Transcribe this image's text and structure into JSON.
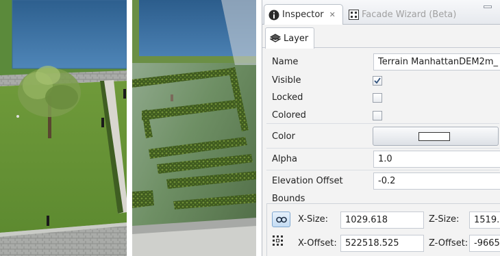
{
  "inspector": {
    "tabs": [
      {
        "label": "Inspector",
        "icon": "info-icon",
        "active": true
      },
      {
        "label": "Facade Wizard (Beta)",
        "icon": "facade-wizard-icon",
        "active": false
      }
    ],
    "subtab": {
      "label": "Layer",
      "icon": "layer-icon"
    },
    "fields": {
      "name": {
        "label": "Name",
        "value": "Terrain ManhattanDEM2m_"
      },
      "visible": {
        "label": "Visible",
        "checked": true
      },
      "locked": {
        "label": "Locked",
        "checked": false
      },
      "colored": {
        "label": "Colored",
        "checked": false
      },
      "color": {
        "label": "Color",
        "value_hex": "#ffffff"
      },
      "alpha": {
        "label": "Alpha",
        "value": "1.0"
      },
      "elevation_offset": {
        "label": "Elevation Offset",
        "value": "-0.2"
      }
    },
    "bounds": {
      "title": "Bounds",
      "x_size_label": "X-Size:",
      "x_size_value": "1029.618",
      "z_size_label": "Z-Size:",
      "z_size_value": "1519.",
      "x_offset_label": "X-Offset:",
      "x_offset_value": "522518.525",
      "z_offset_label": "Z-Offset:",
      "z_offset_value": "-9665"
    }
  },
  "colors": {
    "panel_bg": "#f3f3f3",
    "accent": "#3c78b4"
  }
}
